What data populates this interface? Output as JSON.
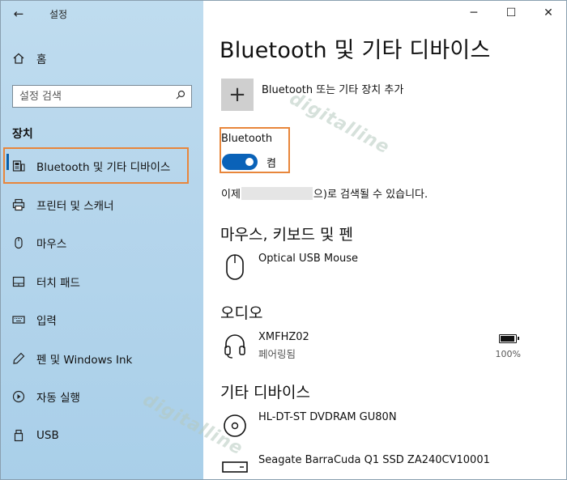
{
  "window": {
    "app_title": "설정",
    "back_icon": "back-arrow-icon",
    "controls": {
      "minimize": "─",
      "maximize": "☐",
      "close": "✕"
    }
  },
  "sidebar": {
    "home_label": "홈",
    "search_placeholder": "설정 검색",
    "section_header": "장치",
    "items": [
      {
        "label": "Bluetooth 및 기타 디바이스",
        "icon": "bluetooth-devices-icon",
        "selected": true
      },
      {
        "label": "프린터 및 스캐너",
        "icon": "printer-icon"
      },
      {
        "label": "마우스",
        "icon": "mouse-icon"
      },
      {
        "label": "터치 패드",
        "icon": "touchpad-icon"
      },
      {
        "label": "입력",
        "icon": "keyboard-icon"
      },
      {
        "label": "펜 및 Windows Ink",
        "icon": "pen-icon"
      },
      {
        "label": "자동 실행",
        "icon": "autoplay-icon"
      },
      {
        "label": "USB",
        "icon": "usb-icon"
      }
    ]
  },
  "main": {
    "title": "Bluetooth 및 기타 디바이스",
    "add_device_label": "Bluetooth 또는 기타 장치 추가",
    "bluetooth": {
      "label": "Bluetooth",
      "state": "켬",
      "on": true
    },
    "discover": {
      "prefix": "이제",
      "suffix": "으)로 검색될 수 있습니다."
    },
    "groups": {
      "mouse_keyboard_pen": {
        "title": "마우스, 키보드 및 펜",
        "devices": [
          {
            "name": "Optical USB Mouse",
            "icon": "mouse-icon"
          }
        ]
      },
      "audio": {
        "title": "오디오",
        "devices": [
          {
            "name": "XMFHZ02",
            "status": "페어링됨",
            "icon": "headset-icon",
            "battery": "100%",
            "battery_level": 1.0
          }
        ]
      },
      "other": {
        "title": "기타 디바이스",
        "devices": [
          {
            "name": "HL-DT-ST DVDRAM GU80N",
            "icon": "optical-drive-icon"
          },
          {
            "name": "Seagate BarraCuda Q1 SSD ZA240CV10001",
            "icon": "drive-icon"
          }
        ]
      }
    }
  },
  "watermarks": [
    "digitalline",
    "digitalline"
  ]
}
